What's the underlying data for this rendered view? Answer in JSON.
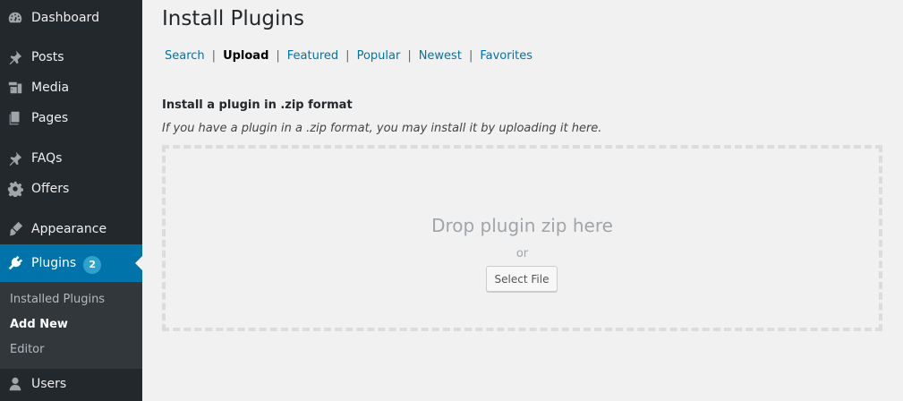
{
  "sidebar": {
    "menu": [
      {
        "label": "Dashboard",
        "icon": "dashboard-icon"
      },
      {
        "label": "Posts",
        "icon": "pin-icon"
      },
      {
        "label": "Media",
        "icon": "media-icon"
      },
      {
        "label": "Pages",
        "icon": "pages-icon"
      },
      {
        "label": "FAQs",
        "icon": "pin-icon"
      },
      {
        "label": "Offers",
        "icon": "gear-icon"
      },
      {
        "label": "Appearance",
        "icon": "brush-icon"
      },
      {
        "label": "Plugins",
        "icon": "plug-icon",
        "badge": "2",
        "active": true
      },
      {
        "label": "Users",
        "icon": "user-icon"
      }
    ],
    "submenu": [
      {
        "label": "Installed Plugins"
      },
      {
        "label": "Add New",
        "current": true
      },
      {
        "label": "Editor"
      }
    ]
  },
  "main": {
    "title": "Install Plugins",
    "filters": [
      {
        "label": "Search"
      },
      {
        "label": "Upload",
        "current": true
      },
      {
        "label": "Featured"
      },
      {
        "label": "Popular"
      },
      {
        "label": "Newest"
      },
      {
        "label": "Favorites"
      }
    ],
    "filter_separator": "|",
    "upload": {
      "heading": "Install a plugin in .zip format",
      "description": "If you have a plugin in a .zip format, you may install it by uploading it here.",
      "drop_text": "Drop plugin zip here",
      "or_text": "or",
      "button_label": "Select File"
    }
  },
  "colors": {
    "sidebar_bg": "#23282d",
    "active_bg": "#0073aa",
    "link": "#0073aa",
    "badge": "#2ea2cc"
  }
}
